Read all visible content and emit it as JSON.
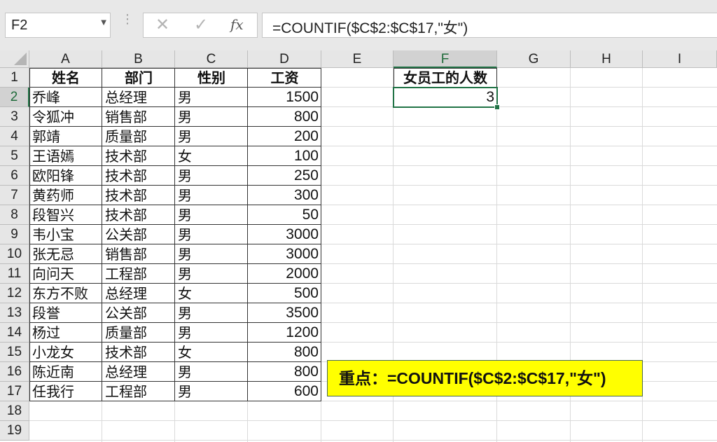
{
  "formula_bar": {
    "name_box": "F2",
    "formula": "=COUNTIF($C$2:$C$17,\"女\")",
    "fx_label": "fx"
  },
  "columns": [
    "A",
    "B",
    "C",
    "D",
    "E",
    "F",
    "G",
    "H",
    "I"
  ],
  "selected_column": "F",
  "rows": [
    "1",
    "2",
    "3",
    "4",
    "5",
    "6",
    "7",
    "8",
    "9",
    "10",
    "11",
    "12",
    "13",
    "14",
    "15",
    "16",
    "17",
    "18",
    "19"
  ],
  "selected_row": "2",
  "table": {
    "headers": [
      "姓名",
      "部门",
      "性别",
      "工资"
    ],
    "rows": [
      [
        "乔峰",
        "总经理",
        "男",
        "1500"
      ],
      [
        "令狐冲",
        "销售部",
        "男",
        "800"
      ],
      [
        "郭靖",
        "质量部",
        "男",
        "200"
      ],
      [
        "王语嫣",
        "技术部",
        "女",
        "100"
      ],
      [
        "欧阳锋",
        "技术部",
        "男",
        "250"
      ],
      [
        "黄药师",
        "技术部",
        "男",
        "300"
      ],
      [
        "段智兴",
        "技术部",
        "男",
        "50"
      ],
      [
        "韦小宝",
        "公关部",
        "男",
        "3000"
      ],
      [
        "张无忌",
        "销售部",
        "男",
        "3000"
      ],
      [
        "向问天",
        "工程部",
        "男",
        "2000"
      ],
      [
        "东方不败",
        "总经理",
        "女",
        "500"
      ],
      [
        "段誉",
        "公关部",
        "男",
        "3500"
      ],
      [
        "杨过",
        "质量部",
        "男",
        "1200"
      ],
      [
        "小龙女",
        "技术部",
        "女",
        "800"
      ],
      [
        "陈近南",
        "总经理",
        "男",
        "800"
      ],
      [
        "任我行",
        "工程部",
        "男",
        "600"
      ]
    ]
  },
  "result": {
    "header": "女员工的人数",
    "value": "3"
  },
  "note": "重点：=COUNTIF($C$2:$C$17,\"女\")",
  "colors": {
    "accent": "#217346",
    "note_bg": "#ffff00"
  }
}
